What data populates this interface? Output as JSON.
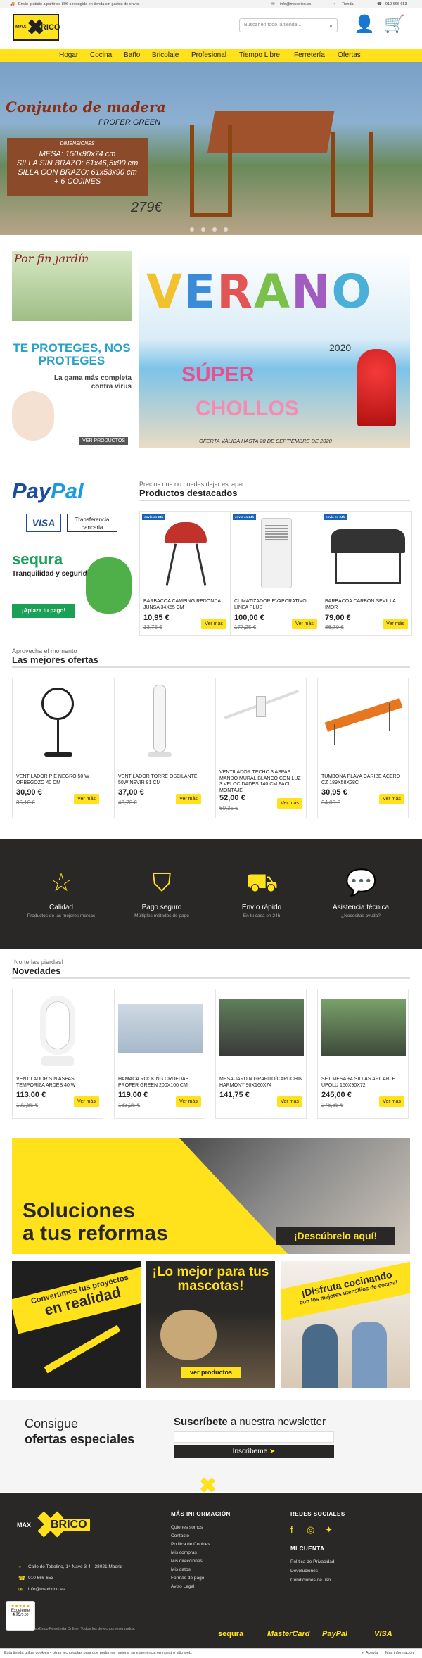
{
  "topbar": {
    "shipping": "Envío gratuito a partir de 80€ o recogida en tienda sin gastos de envío.",
    "email": "info@maxbrico.es",
    "store": "Tienda",
    "phone": "910 666 653"
  },
  "header": {
    "logo_max": "MAX",
    "logo_brico": "BRICO",
    "search_placeholder": "Buscar en todo la tienda..."
  },
  "nav": [
    "Hogar",
    "Cocina",
    "Baño",
    "Bricolaje",
    "Profesional",
    "Tiempo Libre",
    "Ferretería",
    "Ofertas"
  ],
  "hero": {
    "title": "Conjunto de madera",
    "subtitle": "PROFER GREEN",
    "dims_label": "DIMENSIONES",
    "lines": [
      "MESA: 150x90x74 cm",
      "SILLA SIN BRAZO: 61x46,5x90 cm",
      "SILLA CON BRAZO: 61x53x90 cm",
      "+ 6 COJINES"
    ],
    "price": "279€"
  },
  "promo_left": {
    "garden": "Por fin jardín",
    "protect": "TE PROTEGES, NOS PROTEGES",
    "range": "La gama más completa contra virus",
    "button": "VER PRODUCTOS"
  },
  "verano": {
    "word": "VERANO",
    "year": "2020",
    "super": "SÚPER",
    "chollos": "CHOLLOS",
    "offer": "OFERTA VÁLIDA HASTA 28 DE SEPTIEMBRE DE 2020"
  },
  "payments_left": {
    "paypal_a": "Pay",
    "paypal_b": "Pal",
    "visa": "VISA",
    "transfer": "Transferencia bancaria",
    "sequra": "sequra",
    "sequra_text": "Tranquilidad y seguridad",
    "sequra_btn": "¡Aplaza tu pago!"
  },
  "featured": {
    "kicker": "Precios que no puedes dejar escapar",
    "title": "Productos destacados",
    "items": [
      {
        "badge": "envío en 24h",
        "name": "BARBACOA CAMPING REDONDA JUNSA 34X55 CM",
        "price": "10,95 €",
        "old": "13,75 €",
        "btn": "Ver más"
      },
      {
        "badge": "envío en 24h",
        "name": "CLIMATIZADOR EVAPORATIVO LINEA PLUS",
        "price": "100,00 €",
        "old": "177,25 €",
        "btn": "Ver más"
      },
      {
        "badge": "envío en 24h",
        "name": "BARBACOA CARBON SEVILLA IMOR",
        "price": "79,00 €",
        "old": "86,70 €",
        "btn": "Ver más"
      }
    ]
  },
  "best": {
    "kicker": "Aprovecha el momento",
    "title": "Las mejores ofertas",
    "items": [
      {
        "name": "VENTILADOR PIE NEGRO 50 W ORBEGOZO 40 CM",
        "price": "30,90 €",
        "old": "36,10 €",
        "btn": "Ver más"
      },
      {
        "name": "VENTILADOR TORRE OSCILANTE 50W NEVIR 81 CM",
        "price": "37,00 €",
        "old": "43,70 €",
        "btn": "Ver más"
      },
      {
        "name": "VENTILADOR TECHO 3 ASPAS MANDO MURAL BLANCO CON LUZ 3 VELOCIDADES 140 CM FACIL MONTAJE",
        "price": "52,00 €",
        "old": "60,35 €",
        "btn": "Ver más"
      },
      {
        "name": "TUMBONA PLAYA CARIBE ACERO CZ 189X58X28C",
        "price": "30,95 €",
        "old": "34,00 €",
        "btn": "Ver más"
      }
    ]
  },
  "features": [
    {
      "title": "Calidad",
      "desc": "Productos de las mejores marcas"
    },
    {
      "title": "Pago seguro",
      "desc": "Múltiples métodos de pago"
    },
    {
      "title": "Envío rápido",
      "desc": "En tu casa en 24h"
    },
    {
      "title": "Asistencia técnica",
      "desc": "¿Necesitas ayuda?"
    }
  ],
  "news": {
    "kicker": "¡No te las pierdas!",
    "title": "Novedades",
    "items": [
      {
        "name": "VENTILADOR SIN ASPAS TEMPORIZA ARDES 40 W",
        "price": "113,00 €",
        "old": "129,85 €",
        "btn": "Ver más"
      },
      {
        "name": "HAMACA ROCKING CRUEDAS PROFER GREEN 200X100 CM",
        "price": "119,00 €",
        "old": "133,25 €",
        "btn": "Ver más"
      },
      {
        "name": "MESA JARDIN GRAFITO/CAPUCHIN HARMONY 90X160X74",
        "price": "141,75 €",
        "old": "",
        "btn": "Ver más"
      },
      {
        "name": "SET MESA +4 SILLAS APILABLE UPOLU 150X90X72",
        "price": "245,00 €",
        "old": "276,85 €",
        "btn": "Ver más"
      }
    ]
  },
  "banner_reformas": {
    "title_a": "Soluciones",
    "title_b": "a tus reformas",
    "button": "¡Descúbrelo aquí!"
  },
  "tiles": {
    "t1_a": "Convertimos tus proyectos",
    "t1_b": "en realidad",
    "t2_title": "¡Lo mejor para tus mascotas!",
    "t2_btn": "ver productos",
    "t3_a": "¡Disfruta cocinando",
    "t3_b": "con los mejores utensilios de cocina!"
  },
  "newsletter": {
    "left_a": "Consigue",
    "left_b": "ofertas especiales",
    "right_bold": "Suscríbete",
    "right_rest": " a nuestra newsletter",
    "button": "Inscríbeme"
  },
  "footer": {
    "address": "Calle de Tobolino, 14 Nave 3-4 · 28021 Madrid",
    "phone": "910 666 653",
    "email": "info@maxbrico.es",
    "info_title": "MÁS INFORMACIÓN",
    "info_links": [
      "Quienes somos",
      "Contacto",
      "Política de Cookies",
      "Mis compras",
      "Mis direcciones",
      "Mis datos",
      "Formas de pago",
      "Aviso Legal"
    ],
    "social_title": "REDES SOCIALES",
    "account_title": "MI CUENTA",
    "account_links": [
      "Política de Privacidad",
      "Devoluciones",
      "Condiciones de uso"
    ],
    "copyright": "© MaxBrico Ferretería Online. Todos los derechos reservados.",
    "pay_logos": [
      "sequra",
      "MasterCard",
      "PayPal",
      "VISA"
    ]
  },
  "rating": {
    "label": "Excelente",
    "score": "4.75",
    "of": "/5.00"
  },
  "cookie": {
    "text": "Esta tienda utiliza cookies y otras tecnologías para que podamos mejorar su experiencia en nuestro sitio web.",
    "accept": "✓ Aceptar",
    "more": "Más información"
  },
  "colors": {
    "brand_yellow": "#ffe21c",
    "dark": "#2a2826",
    "badge_blue": "#1a64b8"
  }
}
